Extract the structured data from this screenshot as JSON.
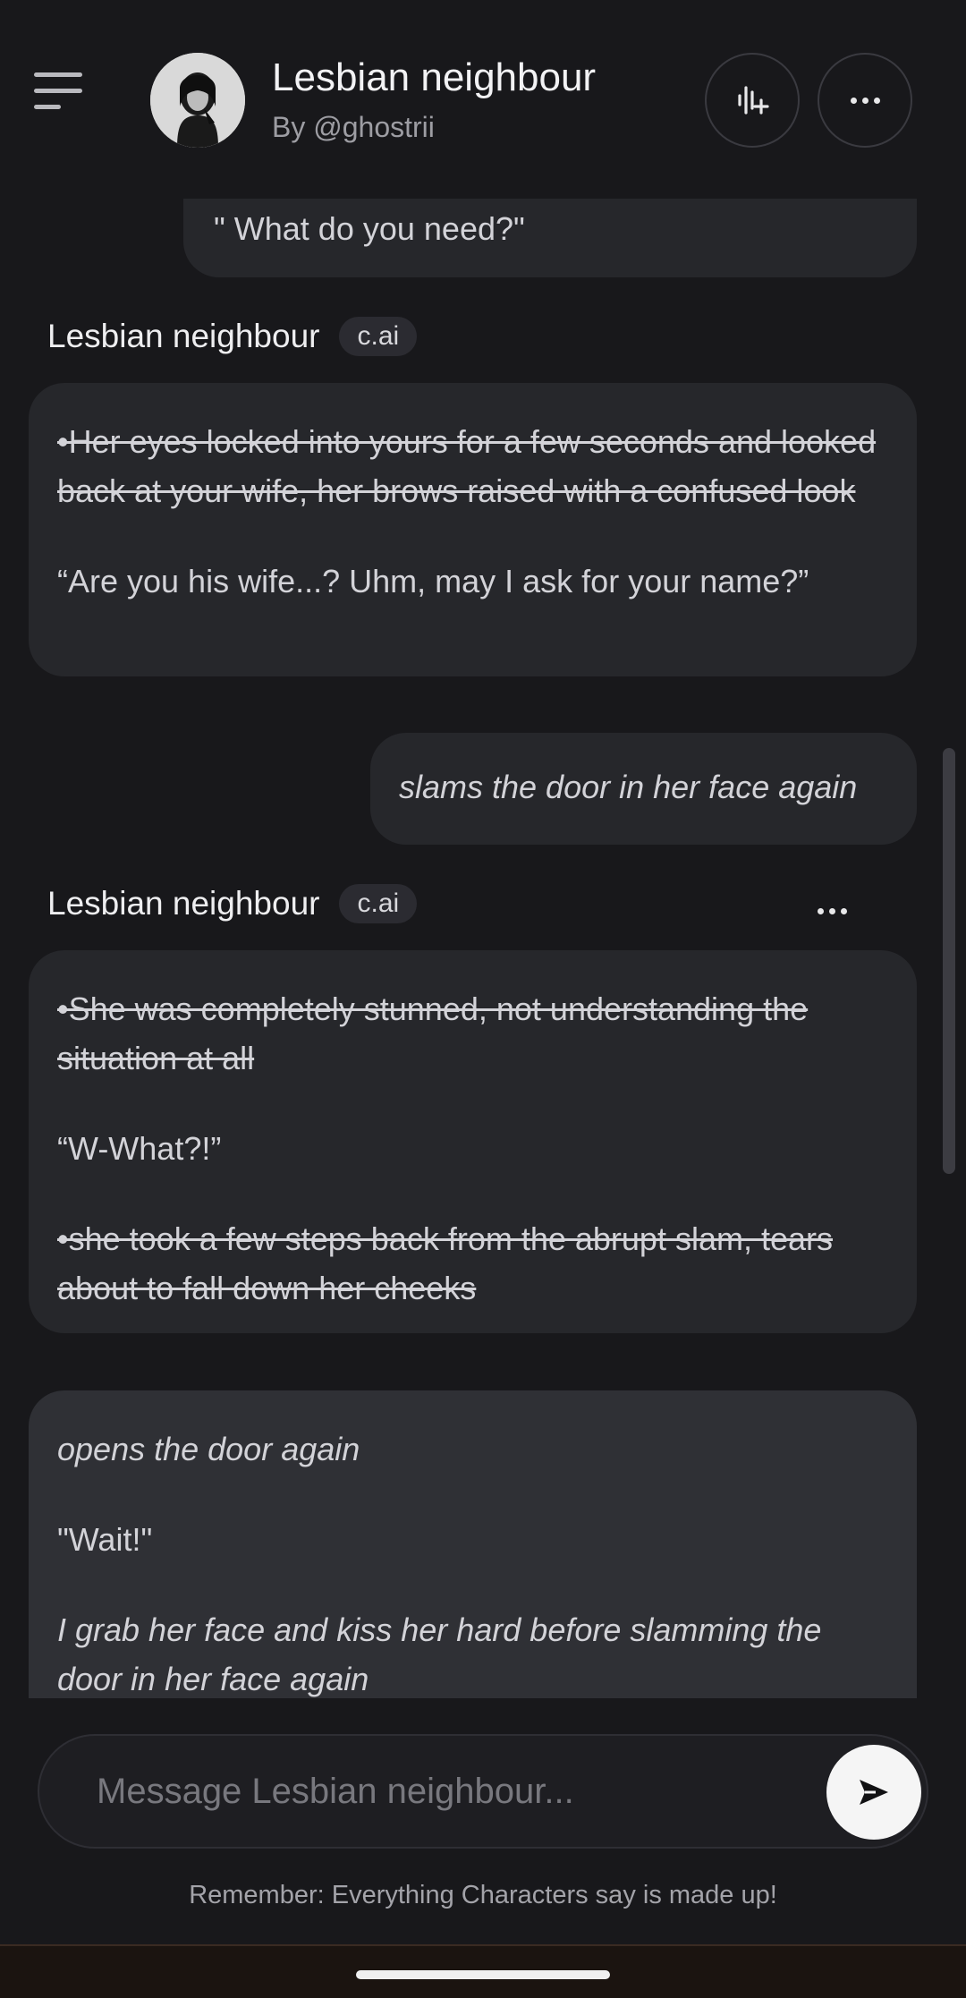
{
  "header": {
    "character_name": "Lesbian neighbour",
    "author": "By @ghostrii",
    "menu_icon": "hamburger-menu-icon",
    "voice_icon": "voice-add-icon",
    "more_icon": "more-dots-icon"
  },
  "messages": {
    "user1_text": "\" What do you need?\"",
    "bot1": {
      "name": "Lesbian neighbour",
      "badge": "c.ai",
      "action": "•Her eyes locked into yours for a few seconds and looked back at your wife, her brows raised with a confused look",
      "speech": "“Are you his wife...? Uhm, may I ask for your name?”"
    },
    "user2_text": "slams the door in her face again",
    "bot2": {
      "name": "Lesbian neighbour",
      "badge": "c.ai",
      "action1": "•She was completely stunned, not understanding the situation at all",
      "speech": "“W-What?!”",
      "action2": "•she took a few steps back from the abrupt slam, tears about to fall down her cheeks"
    },
    "user3": {
      "line1": "opens the door again",
      "line2": "\"Wait!\"",
      "line3": "I grab her face and kiss her hard before slamming the door in her face again"
    }
  },
  "composer": {
    "placeholder": "Message Lesbian neighbour...",
    "send_icon": "send-icon"
  },
  "disclaimer": "Remember: Everything Characters say is made up!"
}
